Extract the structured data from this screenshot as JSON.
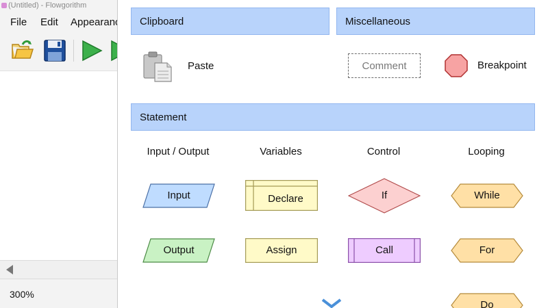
{
  "window": {
    "title": "(Untitled) - Flowgorithm"
  },
  "menu": [
    "File",
    "Edit",
    "Appearanc"
  ],
  "status": {
    "zoom": "300%"
  },
  "popup": {
    "clipboard": {
      "header": "Clipboard",
      "paste_label": "Paste"
    },
    "misc": {
      "header": "Miscellaneous",
      "comment_label": "Comment",
      "breakpoint_label": "Breakpoint"
    },
    "statement": {
      "header": "Statement",
      "columns": [
        "Input / Output",
        "Variables",
        "Control",
        "Looping"
      ],
      "shapes": {
        "input": "Input",
        "output": "Output",
        "declare": "Declare",
        "assign": "Assign",
        "if": "If",
        "call": "Call",
        "while": "While",
        "for": "For",
        "do": "Do"
      }
    }
  },
  "colors": {
    "header_fill": "#b8d3fb",
    "input_output": "#bfdcff",
    "output": "#c9f2c4",
    "variables": "#fffac8",
    "control_if": "#fcd0d0",
    "call": "#eeccff",
    "looping": "#ffe0a6",
    "breakpoint": "#f7a3a3"
  },
  "icons": [
    "open-folder-icon",
    "save-disk-icon",
    "run-icon",
    "step-icon",
    "paste-clipboard-icon",
    "breakpoint-octagon-icon",
    "chevron-down-icon",
    "scroll-left-icon"
  ]
}
